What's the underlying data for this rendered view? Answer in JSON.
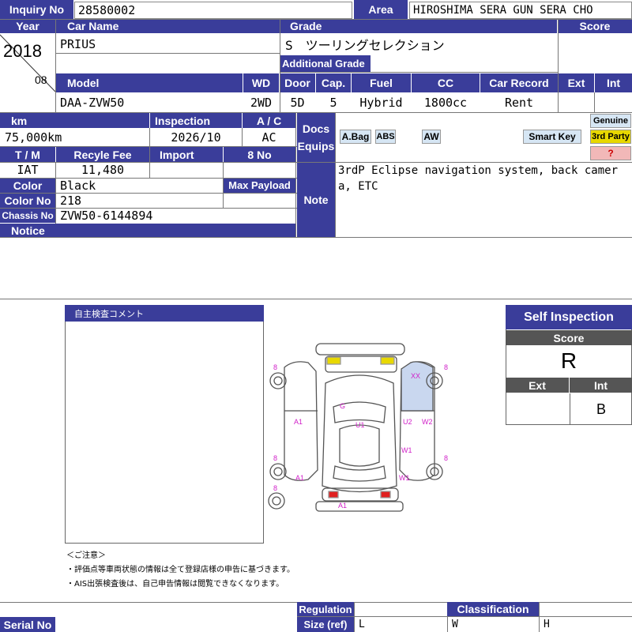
{
  "labels": {
    "inquiry_no": "Inquiry No",
    "area": "Area",
    "year": "Year",
    "car_name": "Car Name",
    "grade": "Grade",
    "score": "Score",
    "additional_grade": "Additional Grade",
    "model": "Model",
    "wd": "WD",
    "door": "Door",
    "cap": "Cap.",
    "fuel": "Fuel",
    "cc": "CC",
    "car_record": "Car Record",
    "ext": "Ext",
    "int": "Int",
    "km": "km",
    "inspection": "Inspection",
    "ac": "A / C",
    "docs": "Docs",
    "equips": "Equips",
    "tm": "T / M",
    "recycle_fee": "Recyle Fee",
    "import": "Import",
    "eight_no": "8 No",
    "color": "Color",
    "max_payload": "Max Payload",
    "color_no": "Color No",
    "chassis_no": "Chassis No",
    "notice": "Notice",
    "note": "Note",
    "regulation": "Regulation",
    "classification": "Classification",
    "serial_no": "Serial No",
    "size_ref": "Size (ref)"
  },
  "values": {
    "inquiry_no": "28580002",
    "area": "HIROSHIMA SERA GUN SERA CHO",
    "year": "2018",
    "month": "08",
    "car_name": "PRIUS",
    "grade": "S　ツーリングセレクション",
    "model": "DAA-ZVW50",
    "wd": "2WD",
    "door": "5D",
    "cap": "5",
    "fuel": "Hybrid",
    "cc": "1800cc",
    "car_record": "Rent",
    "km": "75,000km",
    "inspection": "2026/10",
    "ac": "AC",
    "tm": "IAT",
    "recycle_fee": "11,480",
    "color": "Black",
    "color_no": "218",
    "chassis_no": "ZVW50-6144894",
    "note": "3rdP Eclipse navigation system, back camera, ETC"
  },
  "equips": {
    "abag": "A.Bag",
    "abs": "ABS",
    "aw": "AW",
    "smart_key": "Smart Key",
    "genuine": "Genuine",
    "third_party": "3rd Party",
    "unknown": "?"
  },
  "comment_title": "自主検査コメント",
  "self_inspection": {
    "title": "Self Inspection",
    "score_label": "Score",
    "score": "R",
    "ext_label": "Ext",
    "int_label": "Int",
    "ext": "",
    "int": "B"
  },
  "notes": {
    "heading": "＜ご注意＞",
    "line1": "・評価点等車両状態の情報は全て登録店様の申告に基づきます。",
    "line2": "・AIS出張検査後は、自己申告情報は閲覧できなくなります。"
  },
  "diagram_marks": [
    "8",
    "8",
    "XX",
    "8",
    "G",
    "A1",
    "U1",
    "U2",
    "W2",
    "W1",
    "8",
    "8",
    "A1",
    "W1",
    "A1"
  ],
  "bottom": {
    "size_l": "L",
    "size_w": "W",
    "size_h": "H"
  },
  "colors": {
    "header": "#3a3d9a",
    "damage_mark": "#d020c8",
    "yellow": "#e8d800",
    "red": "#e02020"
  }
}
